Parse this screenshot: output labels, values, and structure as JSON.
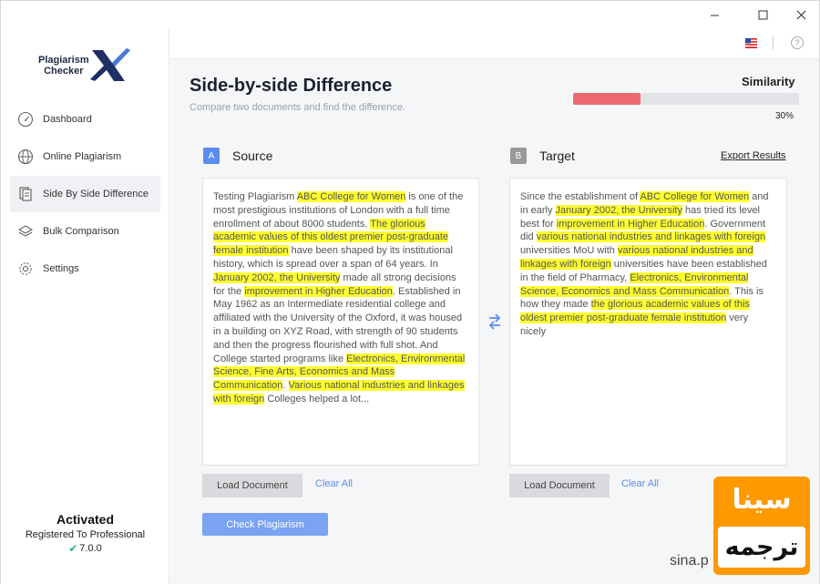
{
  "sidebar": {
    "logo": {
      "line1": "Plagiarism",
      "line2": "Checker",
      "mark": "X"
    },
    "items": [
      {
        "label": "Dashboard",
        "icon": "gauge-icon"
      },
      {
        "label": "Online Plagiarism",
        "icon": "globe-icon"
      },
      {
        "label": "Side By Side Difference",
        "icon": "document-icon"
      },
      {
        "label": "Bulk Comparison",
        "icon": "layers-icon"
      },
      {
        "label": "Settings",
        "icon": "gear-icon"
      }
    ],
    "activation": {
      "title": "Activated",
      "subtitle": "Registered To Professional",
      "version": "7.0.0"
    }
  },
  "header": {
    "language_icon": "us-flag-icon",
    "help_label": "?"
  },
  "page": {
    "title": "Side-by-side Difference",
    "subtitle": "Compare two documents and find the difference."
  },
  "similarity": {
    "label": "Similarity",
    "value_text": "30%",
    "value": 0.3
  },
  "source": {
    "badge": "A",
    "title": "Source",
    "load_label": "Load Document",
    "clear_label": "Clear All",
    "text": {
      "s1": "Testing Plagiarism ",
      "h1": "ABC College for Women",
      "s2": " is one of the most prestigious institutions of London with a full time enrollment of about 8000 students. ",
      "h2": "The glorious academic values of this oldest premier post-graduate female institution",
      "s3": " have been shaped by its institutional history, which is spread over a span of 64 years. In ",
      "h3": "January 2002, the University",
      "s4": " made all strong decisions for the ",
      "h4": "improvement in Higher Education",
      "s5": ". Established in May 1962 as an Intermediate residential college and affiliated with the University of the Oxford, it was housed in a building on XYZ Road, with strength of 90 students and then the progress flourished with full shot. And College started programs like ",
      "h5": "Electronics, Environmental Science, Fine Arts, Economics and Mass Communication",
      "s6": ". ",
      "h6": "Various national industries and linkages with foreign",
      "s7": " Colleges helped a lot..."
    }
  },
  "target": {
    "badge": "B",
    "title": "Target",
    "export_label": "Export Results",
    "load_label": "Load Document",
    "clear_label": "Clear All",
    "text": {
      "s1": "Since the establishment of ",
      "h1": "ABC College for Women",
      "s2": " and in early ",
      "h2": "January 2002, the University",
      "s3": " has tried its level best for ",
      "h3": "improvement in Higher Education",
      "s4": ". Government did ",
      "h4": "various national industries and linkages with foreign",
      "s5": " universities MoU with ",
      "h5": "various national industries and linkages with foreign",
      "s6": " universities have been established in the field of Pharmacy, ",
      "h6": "Electronics, Environmental Science, Economics and Mass Communication",
      "s7": ". This is how they made ",
      "h7": "the glorious academic values of this oldest premier post-graduate female institution",
      "s8": " very nicely"
    }
  },
  "actions": {
    "check_label": "Check Plagiarism",
    "swap_icon": "swap-arrows-icon"
  },
  "watermark": {
    "top": "سینا",
    "bottom": "ترجمه",
    "url": "sina.p"
  },
  "colors": {
    "accent": "#5b8def",
    "highlight": "#ffff2e",
    "similarity_fill": "#ec6a6f",
    "check_button": "#7aa3f2"
  }
}
